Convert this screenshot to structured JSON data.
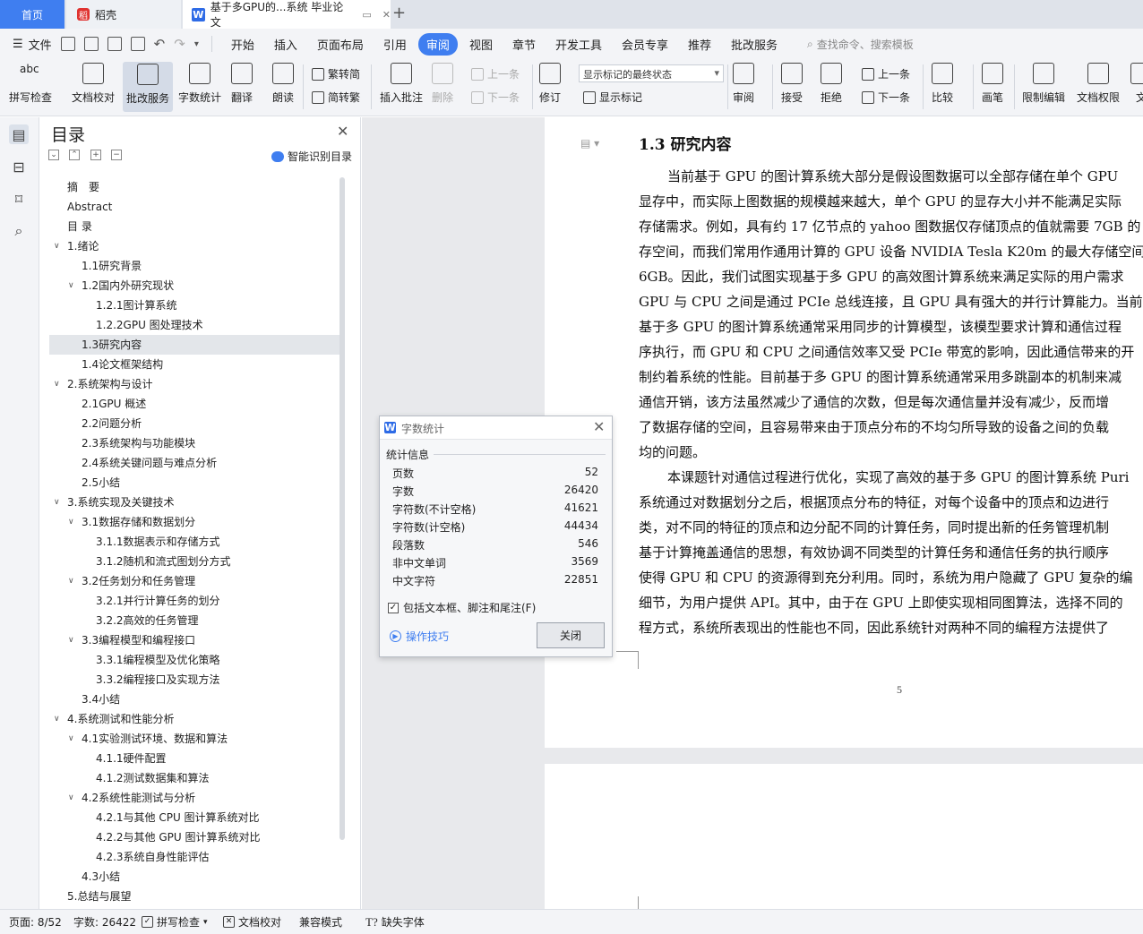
{
  "tabs": {
    "home": "首页",
    "daoke": "稻壳",
    "document": "基于多GPU的...系统 毕业论文"
  },
  "menubar": {
    "file": "文件",
    "items": [
      "开始",
      "插入",
      "页面布局",
      "引用",
      "审阅",
      "视图",
      "章节",
      "开发工具",
      "会员专享",
      "推荐",
      "批改服务"
    ],
    "active_item": "审阅",
    "search_placeholder": "查找命令、搜索模板"
  },
  "ribbon": {
    "spell_check": "拼写检查",
    "doc_proof": "文档校对",
    "review_service": "批改服务",
    "word_count": "字数统计",
    "translate": "翻译",
    "read_aloud": "朗读",
    "trad_to_simp": "繁转简",
    "simp_to_trad": "简转繁",
    "insert_comment": "插入批注",
    "delete": "删除",
    "prev": "上一条",
    "next": "下一条",
    "track_changes": "修订",
    "markup_state": "显示标记的最终状态",
    "show_markup": "显示标记",
    "review": "审阅",
    "accept": "接受",
    "reject": "拒绝",
    "prev_change": "上一条",
    "next_change": "下一条",
    "compare": "比较",
    "pen": "画笔",
    "restrict_edit": "限制编辑",
    "doc_permission": "文档权限",
    "doc_more": "文"
  },
  "toc": {
    "title": "目录",
    "smart_label": "智能识别目录",
    "items": [
      {
        "text": "摘　要",
        "level": 0,
        "caret": false
      },
      {
        "text": "Abstract",
        "level": 0,
        "caret": false
      },
      {
        "text": "目  录",
        "level": 0,
        "caret": false
      },
      {
        "text": "1.绪论",
        "level": 0,
        "caret": true
      },
      {
        "text": "1.1研究背景",
        "level": 1,
        "caret": false
      },
      {
        "text": "1.2国内外研究现状",
        "level": 1,
        "caret": true
      },
      {
        "text": "1.2.1图计算系统",
        "level": 2,
        "caret": false
      },
      {
        "text": "1.2.2GPU 图处理技术",
        "level": 2,
        "caret": false
      },
      {
        "text": "1.3研究内容",
        "level": 1,
        "caret": false,
        "selected": true
      },
      {
        "text": "1.4论文框架结构",
        "level": 1,
        "caret": false
      },
      {
        "text": "2.系统架构与设计",
        "level": 0,
        "caret": true
      },
      {
        "text": "2.1GPU 概述",
        "level": 1,
        "caret": false
      },
      {
        "text": "2.2问题分析",
        "level": 1,
        "caret": false
      },
      {
        "text": "2.3系统架构与功能模块",
        "level": 1,
        "caret": false
      },
      {
        "text": "2.4系统关键问题与难点分析",
        "level": 1,
        "caret": false
      },
      {
        "text": "2.5小结",
        "level": 1,
        "caret": false
      },
      {
        "text": "3.系统实现及关键技术",
        "level": 0,
        "caret": true
      },
      {
        "text": "3.1数据存储和数据划分",
        "level": 1,
        "caret": true
      },
      {
        "text": "3.1.1数据表示和存储方式",
        "level": 2,
        "caret": false
      },
      {
        "text": "3.1.2随机和流式图划分方式",
        "level": 2,
        "caret": false
      },
      {
        "text": "3.2任务划分和任务管理",
        "level": 1,
        "caret": true
      },
      {
        "text": "3.2.1并行计算任务的划分",
        "level": 2,
        "caret": false
      },
      {
        "text": "3.2.2高效的任务管理",
        "level": 2,
        "caret": false
      },
      {
        "text": "3.3编程模型和编程接口",
        "level": 1,
        "caret": true
      },
      {
        "text": "3.3.1编程模型及优化策略",
        "level": 2,
        "caret": false
      },
      {
        "text": "3.3.2编程接口及实现方法",
        "level": 2,
        "caret": false
      },
      {
        "text": "3.4小结",
        "level": 1,
        "caret": false
      },
      {
        "text": "4.系统测试和性能分析",
        "level": 0,
        "caret": true
      },
      {
        "text": "4.1实验测试环境、数据和算法",
        "level": 1,
        "caret": true
      },
      {
        "text": "4.1.1硬件配置",
        "level": 2,
        "caret": false
      },
      {
        "text": "4.1.2测试数据集和算法",
        "level": 2,
        "caret": false
      },
      {
        "text": "4.2系统性能测试与分析",
        "level": 1,
        "caret": true
      },
      {
        "text": "4.2.1与其他 CPU 图计算系统对比",
        "level": 2,
        "caret": false
      },
      {
        "text": "4.2.2与其他 GPU 图计算系统对比",
        "level": 2,
        "caret": false
      },
      {
        "text": "4.2.3系统自身性能评估",
        "level": 2,
        "caret": false
      },
      {
        "text": "4.3小结",
        "level": 1,
        "caret": false
      },
      {
        "text": "5.总结与展望",
        "level": 0,
        "caret": false
      }
    ]
  },
  "document": {
    "heading": "1.3 研究内容",
    "paragraph1": [
      "当前基于 GPU 的图计算系统大部分是假设图数据可以全部存储在单个 GPU",
      "显存中，而实际上图数据的规模越来越大，单个 GPU 的显存大小并不能满足实际",
      "存储需求。例如，具有约 17 亿节点的 yahoo 图数据仅存储顶点的值就需要 7GB 的",
      "存空间，而我们常用作通用计算的 GPU 设备 NVIDIA Tesla K20m 的最大存储空间",
      "6GB。因此，我们试图实现基于多 GPU 的高效图计算系统来满足实际的用户需求",
      "GPU 与 CPU 之间是通过 PCIe 总线连接，且 GPU 具有强大的并行计算能力。当前",
      "基于多 GPU 的图计算系统通常采用同步的计算模型，该模型要求计算和通信过程",
      "序执行，而 GPU 和 CPU 之间通信效率又受 PCIe 带宽的影响，因此通信带来的开",
      "制约着系统的性能。目前基于多 GPU 的图计算系统通常采用多跳副本的机制来减",
      "通信开销，该方法虽然减少了通信的次数，但是每次通信量并没有减少，反而增",
      "了数据存储的空间，且容易带来由于顶点分布的不均匀所导致的设备之间的负载",
      "均的问题。"
    ],
    "paragraph2": [
      "本课题针对通信过程进行优化，实现了高效的基于多 GPU 的图计算系统 Puri",
      "系统通过对数据划分之后，根据顶点分布的特征，对每个设备中的顶点和边进行",
      "类，对不同的特征的顶点和边分配不同的计算任务，同时提出新的任务管理机制",
      "基于计算掩盖通信的思想，有效协调不同类型的计算任务和通信任务的执行顺序",
      "使得 GPU 和 CPU 的资源得到充分利用。同时，系统为用户隐藏了 GPU 复杂的编",
      "细节，为用户提供 API。其中，由于在 GPU 上即使实现相同图算法，选择不同的",
      "程方式，系统所表现出的性能也不同，因此系统针对两种不同的编程方法提供了"
    ],
    "page_number": "5"
  },
  "word_count_dialog": {
    "title": "字数统计",
    "section": "统计信息",
    "rows": [
      {
        "label": "页数",
        "value": "52"
      },
      {
        "label": "字数",
        "value": "26420"
      },
      {
        "label": "字符数(不计空格)",
        "value": "41621"
      },
      {
        "label": "字符数(计空格)",
        "value": "44434"
      },
      {
        "label": "段落数",
        "value": "546"
      },
      {
        "label": "非中文单词",
        "value": "3569"
      },
      {
        "label": "中文字符",
        "value": "22851"
      }
    ],
    "include_option": "包括文本框、脚注和尾注(F)",
    "include_checked": true,
    "tips": "操作技巧",
    "close_button": "关闭"
  },
  "statusbar": {
    "page": "页面: 8/52",
    "words": "字数: 26422",
    "spell_check": "拼写检查",
    "doc_proof": "文档校对",
    "compat_mode": "兼容模式",
    "missing_fonts": "缺失字体"
  },
  "colors": {
    "accent": "#3f7ef0",
    "tab_bar": "#dfe3ea",
    "toolbar": "#f3f4f7",
    "doc_background": "#e8e9ec"
  }
}
